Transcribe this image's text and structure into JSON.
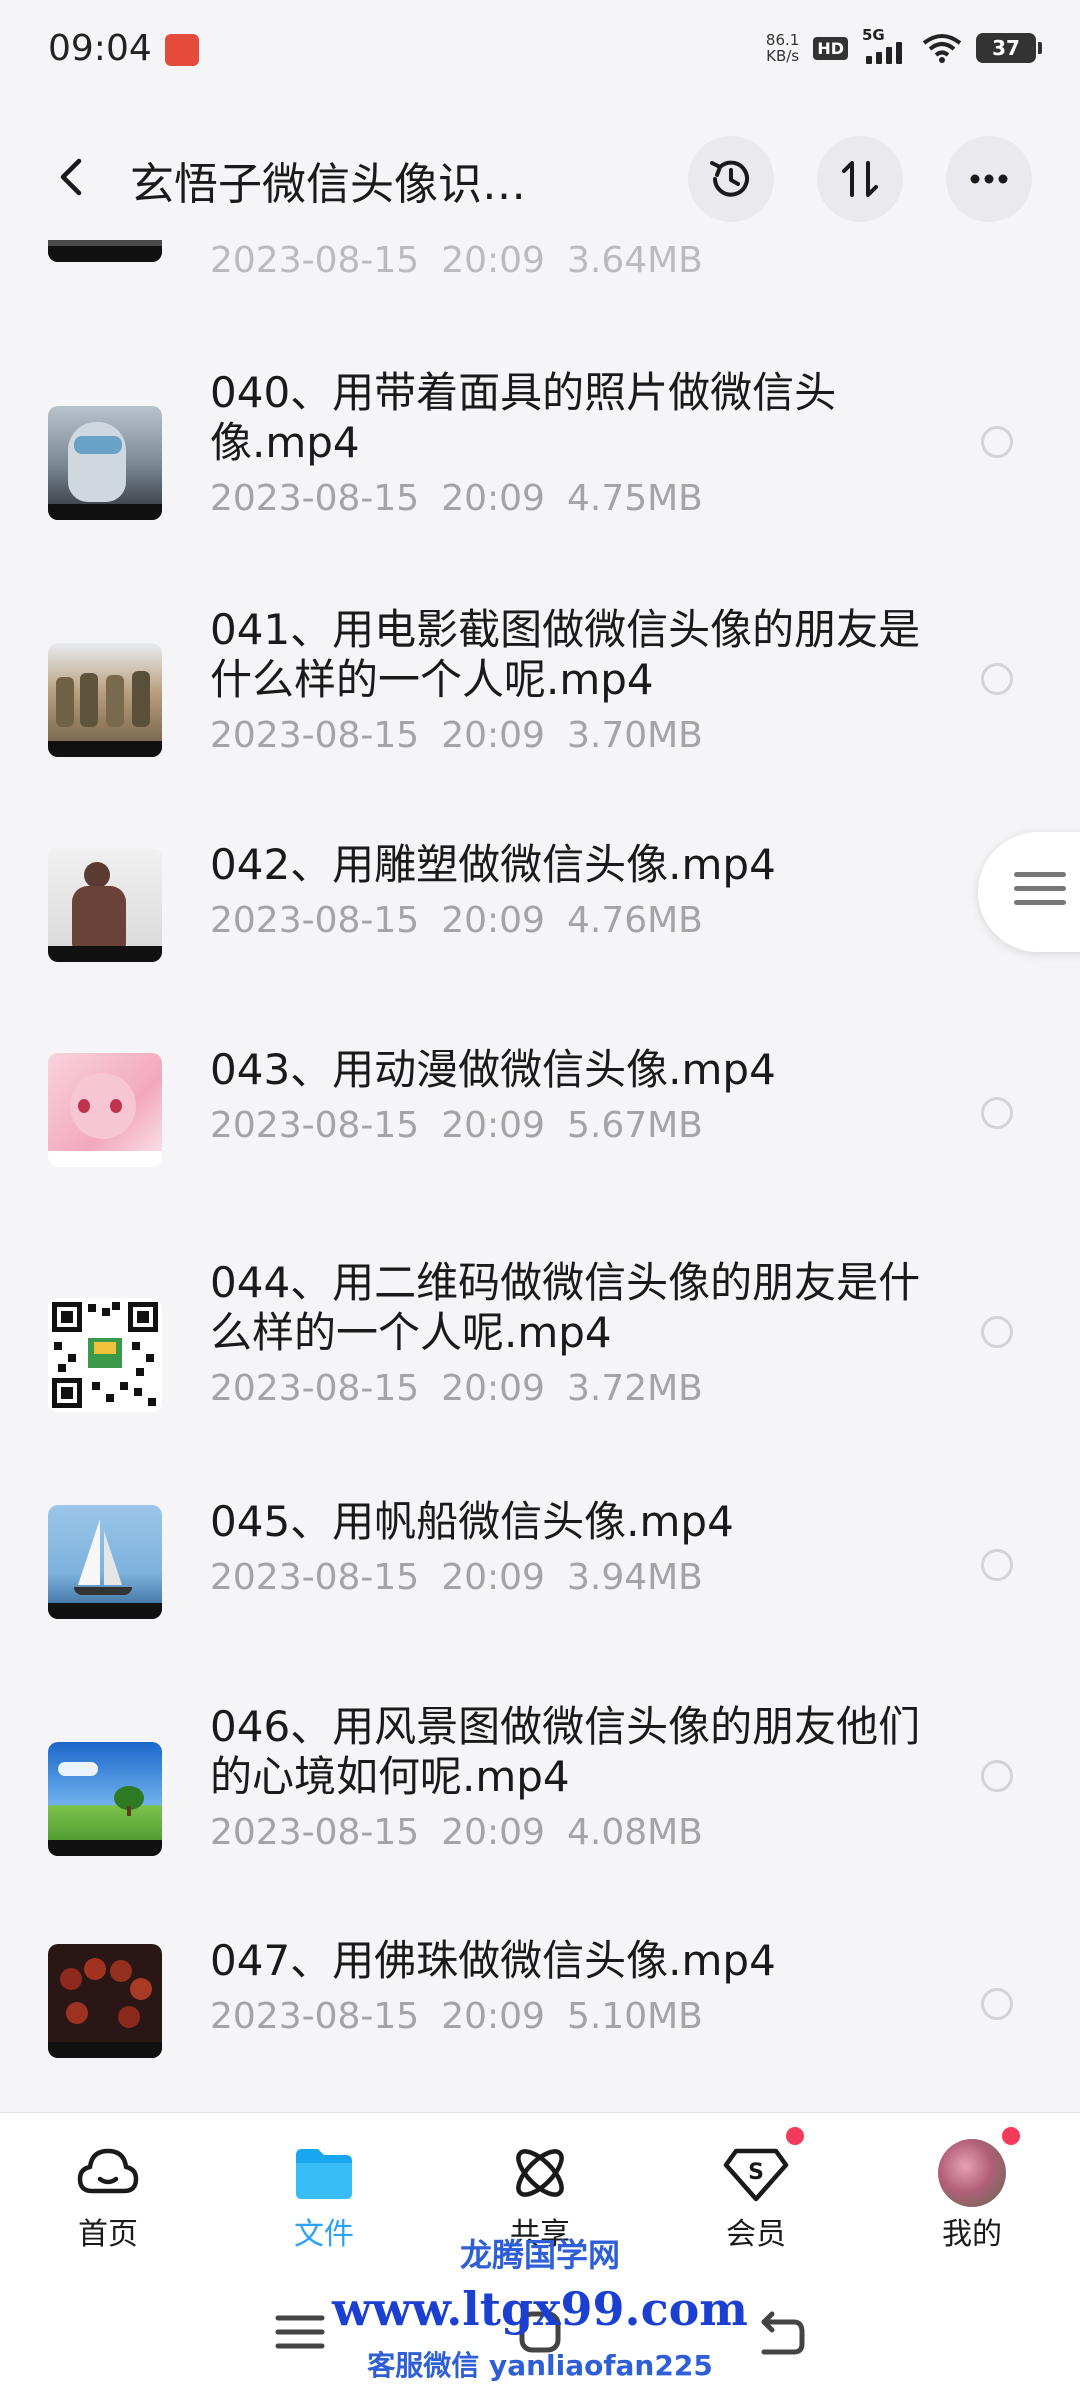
{
  "status_bar": {
    "time": "09:04",
    "net_speed_value": "86.1",
    "net_speed_unit": "KB/s",
    "hd": "HD",
    "network": "5G",
    "battery": "37"
  },
  "header": {
    "title": "玄悟子微信头像识…",
    "icons": [
      "back-icon",
      "history-icon",
      "sort-icon",
      "more-icon"
    ]
  },
  "files": [
    {
      "name": "",
      "date": "2023-08-15",
      "time": "20:09",
      "size": "3.64MB"
    },
    {
      "name": "040、用带着面具的照片做微信头像.mp4",
      "date": "2023-08-15",
      "time": "20:09",
      "size": "4.75MB"
    },
    {
      "name": "041、用电影截图做微信头像的朋友是什么样的一个人呢.mp4",
      "date": "2023-08-15",
      "time": "20:09",
      "size": "3.70MB"
    },
    {
      "name": "042、用雕塑做微信头像.mp4",
      "date": "2023-08-15",
      "time": "20:09",
      "size": "4.76MB"
    },
    {
      "name": "043、用动漫做微信头像.mp4",
      "date": "2023-08-15",
      "time": "20:09",
      "size": "5.67MB"
    },
    {
      "name": "044、用二维码做微信头像的朋友是什么样的一个人呢.mp4",
      "date": "2023-08-15",
      "time": "20:09",
      "size": "3.72MB"
    },
    {
      "name": "045、用帆船微信头像.mp4",
      "date": "2023-08-15",
      "time": "20:09",
      "size": "3.94MB"
    },
    {
      "name": "046、用风景图做微信头像的朋友他们的心境如何呢.mp4",
      "date": "2023-08-15",
      "time": "20:09",
      "size": "4.08MB"
    },
    {
      "name": "047、用佛珠做微信头像.mp4",
      "date": "2023-08-15",
      "time": "20:09",
      "size": "5.10MB"
    }
  ],
  "bottom_nav": [
    {
      "label": "首页",
      "icon": "cloud-icon",
      "active": false
    },
    {
      "label": "文件",
      "icon": "folder-icon",
      "active": true
    },
    {
      "label": "共享",
      "icon": "share-atom-icon",
      "active": false
    },
    {
      "label": "会员",
      "icon": "vip-diamond-icon",
      "active": false
    },
    {
      "label": "我的",
      "icon": "avatar",
      "active": false
    }
  ],
  "watermark": {
    "line1": "龙腾国学网",
    "line2": "www.ltgx99.com",
    "line3": "客服微信 yanliaofan225"
  },
  "colors": {
    "accent": "#2aa3f5",
    "badge": "#f23a5c",
    "meta_text": "#a3a3a8",
    "background": "#f5f5f7"
  }
}
